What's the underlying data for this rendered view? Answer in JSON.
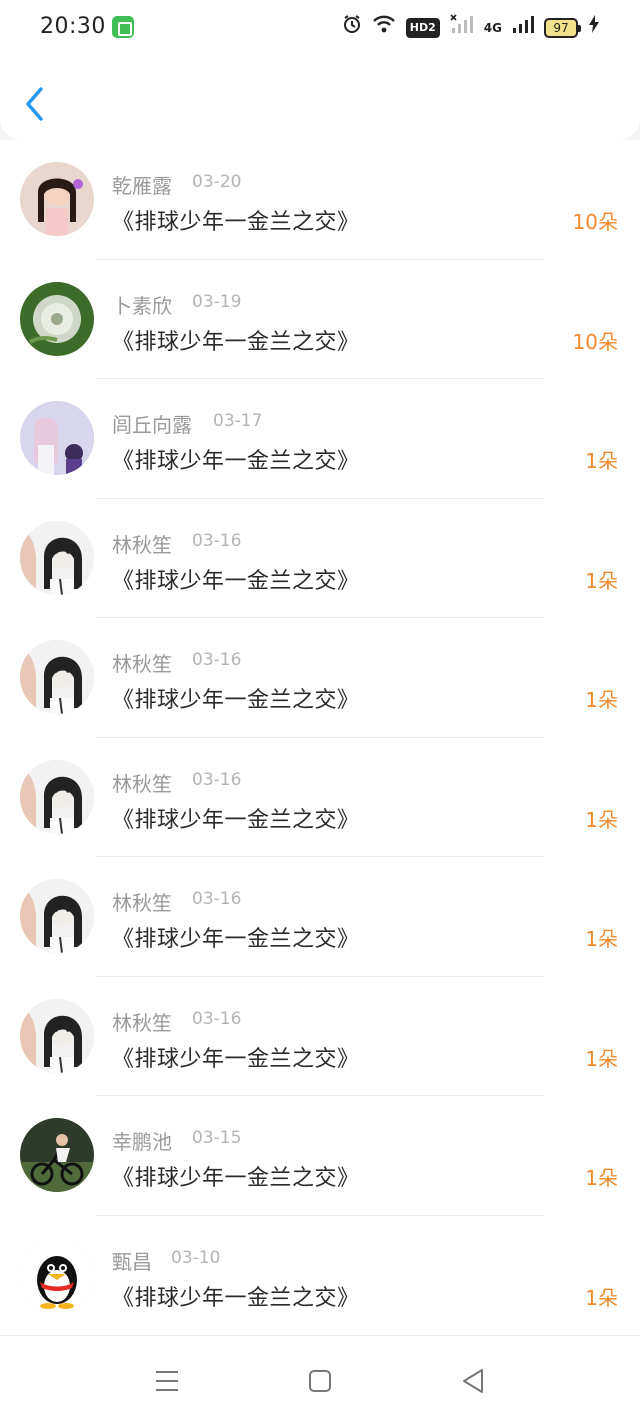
{
  "status_bar": {
    "time": "20:30",
    "hd_label": "HD2",
    "network_label": "4G",
    "battery_level": "97"
  },
  "header": {
    "back_icon": "chevron-left-icon",
    "accent_color": "#2196f3"
  },
  "records": [
    {
      "name": "乾雁露",
      "date": "03-20",
      "title": "《排球少年一金兰之交》",
      "amount": "10朵",
      "avatar": "avatar-girl-pink"
    },
    {
      "name": "卜素欣",
      "date": "03-19",
      "title": "《排球少年一金兰之交》",
      "amount": "10朵",
      "avatar": "avatar-dandelion"
    },
    {
      "name": "闾丘向露",
      "date": "03-17",
      "title": "《排球少年一金兰之交》",
      "amount": "1朵",
      "avatar": "avatar-anime"
    },
    {
      "name": "林秋笙",
      "date": "03-16",
      "title": "《排球少年一金兰之交》",
      "amount": "1朵",
      "avatar": "avatar-girl-bw"
    },
    {
      "name": "林秋笙",
      "date": "03-16",
      "title": "《排球少年一金兰之交》",
      "amount": "1朵",
      "avatar": "avatar-girl-bw"
    },
    {
      "name": "林秋笙",
      "date": "03-16",
      "title": "《排球少年一金兰之交》",
      "amount": "1朵",
      "avatar": "avatar-girl-bw"
    },
    {
      "name": "林秋笙",
      "date": "03-16",
      "title": "《排球少年一金兰之交》",
      "amount": "1朵",
      "avatar": "avatar-girl-bw"
    },
    {
      "name": "林秋笙",
      "date": "03-16",
      "title": "《排球少年一金兰之交》",
      "amount": "1朵",
      "avatar": "avatar-girl-bw"
    },
    {
      "name": "幸鹏池",
      "date": "03-15",
      "title": "《排球少年一金兰之交》",
      "amount": "1朵",
      "avatar": "avatar-cyclist"
    },
    {
      "name": "甄昌",
      "date": "03-10",
      "title": "《排球少年一金兰之交》",
      "amount": "1朵",
      "avatar": "avatar-penguin"
    }
  ],
  "colors": {
    "amount": "#f28a2b",
    "name": "#9a9a9a",
    "date": "#b4b4b4",
    "title": "#2b2b2b"
  },
  "nav_bar": {
    "menu_icon": "menu-icon",
    "home_icon": "home-square-icon",
    "back_icon": "back-triangle-icon"
  }
}
